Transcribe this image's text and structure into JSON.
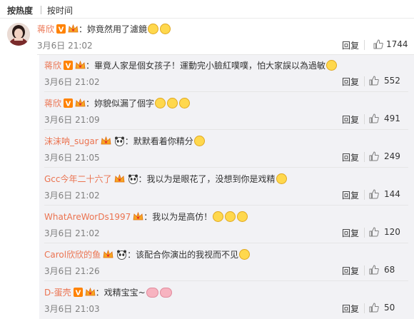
{
  "tabs": [
    "按热度",
    "按时间"
  ],
  "main_comment": {
    "user": "蒋欣",
    "text": "：妳竟然用了濾鏡",
    "time": "3月6日 21:02",
    "reply": "回复",
    "likes": "1744",
    "emoji": [
      "smirk",
      "smirk"
    ]
  },
  "replies": [
    {
      "user": "蒋欣",
      "text": "：畢竟人家是個女孩子！運動完小臉紅噗噗，怕大家誤以為過敏",
      "time": "3月6日 21:02",
      "reply": "回复",
      "likes": "552",
      "badges": [
        "v",
        "crown"
      ],
      "emoji": [
        "laugh"
      ]
    },
    {
      "user": "蒋欣",
      "text": "：妳貌似漏了個字",
      "time": "3月6日 21:09",
      "reply": "回复",
      "likes": "491",
      "badges": [
        "v",
        "crown"
      ],
      "emoji": [
        "smirk",
        "smirk",
        "smirk"
      ]
    },
    {
      "user": "沫沫呐_sugar",
      "text": "：默默看着你精分",
      "time": "3月6日 21:05",
      "reply": "回复",
      "likes": "249",
      "badges": [
        "crown",
        "panda"
      ],
      "emoji": [
        "tongue"
      ]
    },
    {
      "user": "Gcc今年二十六了",
      "text": "：我以为是眼花了，没想到你是戏精",
      "time": "3月6日 21:02",
      "reply": "回复",
      "likes": "144",
      "badges": [
        "crown",
        "panda"
      ],
      "emoji": [
        "laugh"
      ]
    },
    {
      "user": "WhatAreWorDs1997",
      "text": "：我以为是高仿！",
      "time": "3月6日 21:02",
      "reply": "回复",
      "likes": "120",
      "badges": [
        "crown"
      ],
      "emoji": [
        "think",
        "think",
        "think"
      ]
    },
    {
      "user": "Carol欣欣的鱼",
      "text": "：该配合你演出的我视而不见",
      "time": "3月6日 21:26",
      "reply": "回复",
      "likes": "68",
      "badges": [
        "crown",
        "panda"
      ],
      "emoji": [
        "smile"
      ]
    },
    {
      "user": "D-蛋壳",
      "text": "：戏精宝宝~",
      "time": "3月6日 21:03",
      "reply": "回复",
      "likes": "50",
      "badges": [
        "v",
        "crown"
      ],
      "emoji": [
        "pig",
        "pig"
      ]
    }
  ],
  "colors": {
    "username": "#eb7350",
    "time": "#808080",
    "panel": "#f2f2f5",
    "vip_badge": "#ff8200"
  }
}
